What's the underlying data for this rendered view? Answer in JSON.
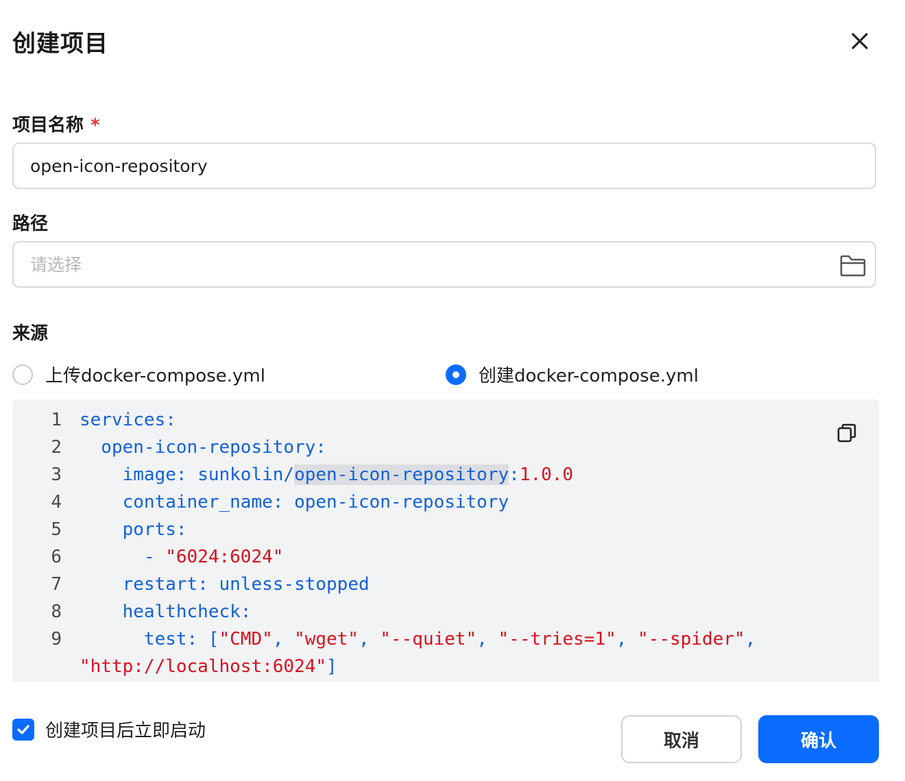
{
  "dialog": {
    "title": "创建项目"
  },
  "form": {
    "name_label": "项目名称",
    "required_mark": "*",
    "name_value": "open-icon-repository",
    "path_label": "路径",
    "path_placeholder": "请选择",
    "source_label": "来源",
    "source_options": [
      {
        "label": "上传docker-compose.yml",
        "checked": false
      },
      {
        "label": "创建docker-compose.yml",
        "checked": true
      }
    ],
    "autostart_label": "创建项目后立即启动",
    "autostart_checked": true
  },
  "editor": {
    "lines": [
      {
        "no": "1",
        "tokens": [
          [
            "k",
            "services:"
          ]
        ]
      },
      {
        "no": "2",
        "tokens": [
          [
            "k",
            "  open-icon-repository:"
          ]
        ]
      },
      {
        "no": "3",
        "tokens": [
          [
            "k",
            "    image: "
          ],
          [
            "v",
            "sunkolin/"
          ],
          [
            "vh",
            "open-icon-repository"
          ],
          [
            "k",
            ":"
          ],
          [
            "s",
            "1.0.0"
          ]
        ]
      },
      {
        "no": "4",
        "tokens": [
          [
            "k",
            "    container_name: "
          ],
          [
            "v",
            "open-icon-repository"
          ]
        ]
      },
      {
        "no": "5",
        "tokens": [
          [
            "k",
            "    ports:"
          ]
        ]
      },
      {
        "no": "6",
        "tokens": [
          [
            "p",
            "      - "
          ],
          [
            "s",
            "\"6024:6024\""
          ]
        ]
      },
      {
        "no": "7",
        "tokens": [
          [
            "k",
            "    restart: "
          ],
          [
            "v",
            "unless-stopped"
          ]
        ]
      },
      {
        "no": "8",
        "tokens": [
          [
            "k",
            "    healthcheck:"
          ]
        ]
      },
      {
        "no": "9",
        "tokens": [
          [
            "k",
            "      test: "
          ],
          [
            "p",
            "["
          ],
          [
            "s",
            "\"CMD\""
          ],
          [
            "p",
            ", "
          ],
          [
            "s",
            "\"wget\""
          ],
          [
            "p",
            ", "
          ],
          [
            "s",
            "\"--quiet\""
          ],
          [
            "p",
            ", "
          ],
          [
            "s",
            "\"--tries=1\""
          ],
          [
            "p",
            ", "
          ],
          [
            "s",
            "\"--spider\""
          ],
          [
            "p",
            ","
          ]
        ]
      }
    ],
    "wrap_tokens": [
      [
        "s",
        "\"http://localhost:6024\""
      ],
      [
        "p",
        "]"
      ]
    ]
  },
  "buttons": {
    "cancel": "取消",
    "confirm": "确认"
  },
  "colors": {
    "primary": "#0a6cff",
    "required": "#e5353d",
    "code_key": "#1361d6",
    "code_string": "#d4121e"
  }
}
